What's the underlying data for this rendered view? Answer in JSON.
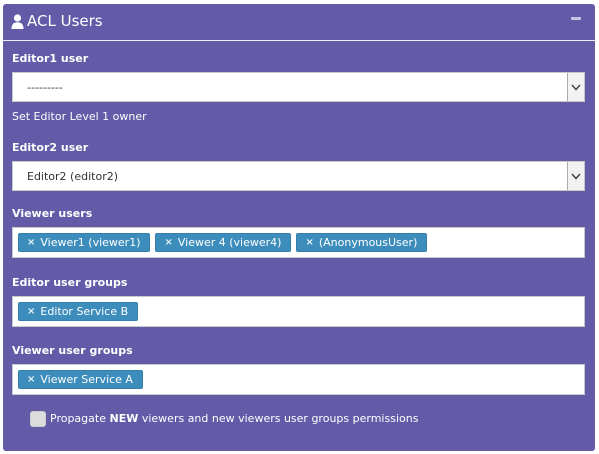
{
  "panel": {
    "title": "ACL Users",
    "collapse_icon": "minus-icon",
    "title_icon": "user-icon"
  },
  "editor1": {
    "label": "Editor1 user",
    "selected": "---------",
    "help": "Set Editor Level 1 owner"
  },
  "editor2": {
    "label": "Editor2 user",
    "selected": "Editor2 (editor2)"
  },
  "viewer_users": {
    "label": "Viewer users",
    "tags": [
      "Viewer1 (viewer1)",
      "Viewer 4 (viewer4)",
      "(AnonymousUser)"
    ]
  },
  "editor_groups": {
    "label": "Editor user groups",
    "tags": [
      "Editor Service B"
    ]
  },
  "viewer_groups": {
    "label": "Viewer user groups",
    "tags": [
      "Viewer Service A"
    ]
  },
  "propagate": {
    "prefix": "Propagate",
    "bold_word": "NEW",
    "suffix": "viewers and new viewers user groups permissions",
    "checked": false
  },
  "tag_remove_glyph": "×",
  "colors": {
    "panel_bg": "#635aa8",
    "tag_bg": "#3c8dbc"
  }
}
